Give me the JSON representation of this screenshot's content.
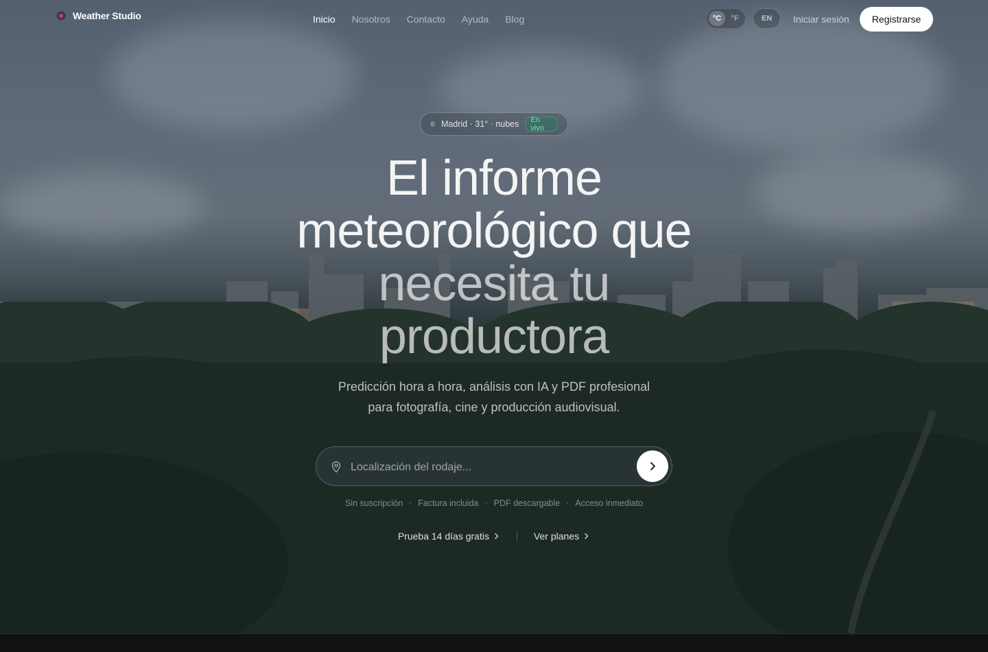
{
  "brand": {
    "name": "Weather Studio"
  },
  "nav": {
    "items": [
      {
        "label": "Inicio",
        "active": true
      },
      {
        "label": "Nosotros",
        "active": false
      },
      {
        "label": "Contacto",
        "active": false
      },
      {
        "label": "Ayuda",
        "active": false
      },
      {
        "label": "Blog",
        "active": false
      }
    ]
  },
  "header": {
    "units": {
      "celsius": "°C",
      "fahrenheit": "°F",
      "selected": "°C"
    },
    "language": "EN",
    "login_label": "Iniciar sesión",
    "signup_label": "Registrarse"
  },
  "hero": {
    "status": {
      "text": "Madrid · 31° · nubes",
      "badge": "En vivo",
      "badge_color": "#6ee7b7"
    },
    "headline": {
      "line1": "El informe",
      "line2": "meteorológico que",
      "line3": "necesita tu",
      "line4": "productora"
    },
    "subtitle_line1": "Predicción hora a hora, análisis con IA y PDF profesional",
    "subtitle_line2": "para fotografía, cine y producción audiovisual.",
    "search": {
      "placeholder": "Localización del rodaje...",
      "value": ""
    },
    "features": [
      "Sin suscripción",
      "Factura incluida",
      "PDF descargable",
      "Acceso inmediato"
    ],
    "feature_separator": "·",
    "links": {
      "trial": "Prueba 14 días gratis",
      "plans": "Ver planes"
    }
  },
  "icons": {
    "brand": "weather-logo-icon",
    "pin": "map-pin-icon",
    "submit": "chevron-right-icon"
  },
  "colors": {
    "accent": "#ffffff",
    "live": "#6ee7b7"
  }
}
